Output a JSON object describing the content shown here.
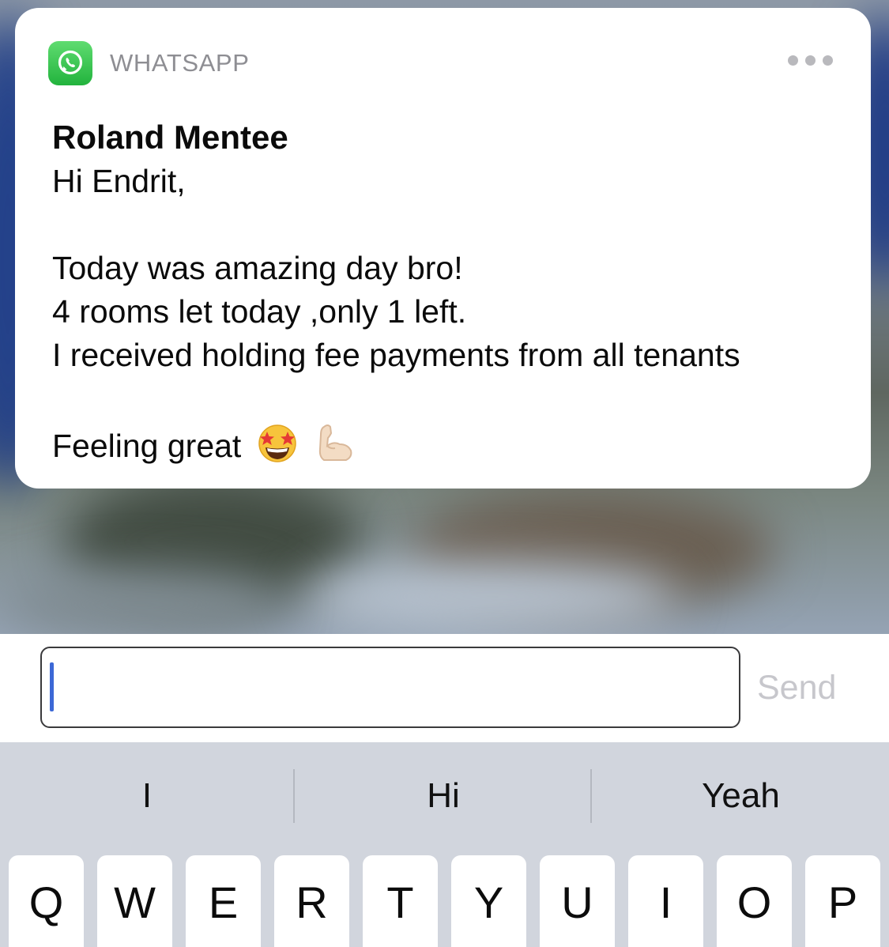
{
  "notification": {
    "app_name": "WHATSAPP",
    "app_icon": "whatsapp-icon",
    "more_icon": "ellipsis-icon",
    "sender": "Roland Mentee",
    "message_lines": [
      "Hi Endrit,",
      "",
      "Today was amazing day bro!",
      "4 rooms let today ,only 1 left.",
      "I received holding fee payments from all tenants",
      "",
      "Feeling great"
    ],
    "emoji": [
      "star-struck-emoji",
      "flexed-biceps-emoji"
    ]
  },
  "reply": {
    "input_value": "",
    "send_label": "Send"
  },
  "keyboard": {
    "suggestions": [
      "I",
      "Hi",
      "Yeah"
    ],
    "top_row": [
      "Q",
      "W",
      "E",
      "R",
      "T",
      "Y",
      "U",
      "I",
      "O",
      "P"
    ]
  },
  "colors": {
    "whatsapp_green": "#25D366",
    "caret_blue": "#3c68d6",
    "send_disabled": "#c7c7cc",
    "keyboard_bg": "#d1d5dd"
  }
}
